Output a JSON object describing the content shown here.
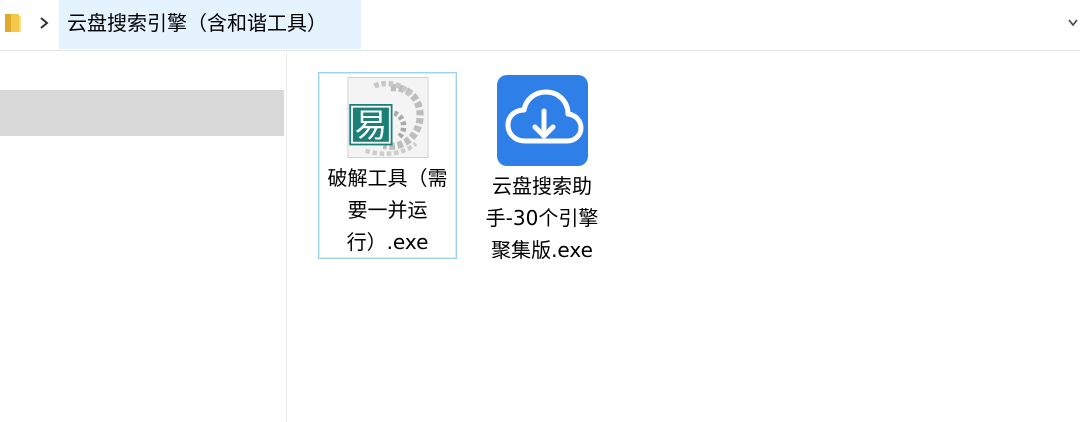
{
  "address_bar": {
    "folder_icon": "folder-icon",
    "separator_icon": "chevron-right-icon",
    "path": "云盘搜索引擎（含和谐工具）",
    "dropdown_icon": "chevron-down-icon"
  },
  "files": [
    {
      "name": "破解工具（需要一并运行）.exe",
      "icon": "easy-language-app-icon",
      "icon_glyph": "易",
      "selected": true
    },
    {
      "name": "云盘搜索助手-30个引擎聚集版.exe",
      "icon": "cloud-download-icon",
      "accent": "#2f7fe8",
      "selected": false
    }
  ]
}
